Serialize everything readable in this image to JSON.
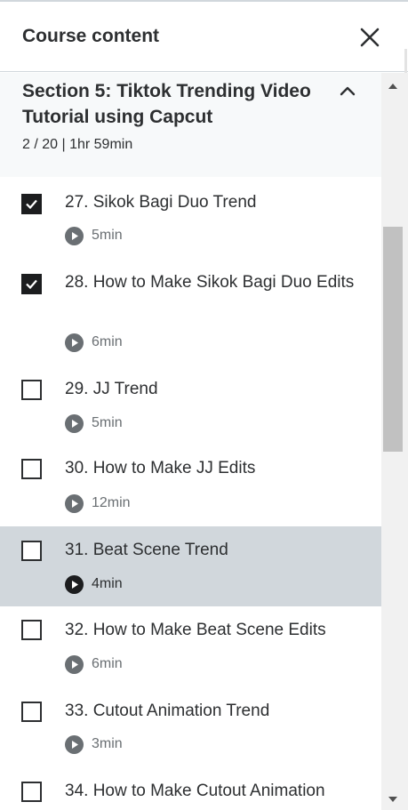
{
  "header": {
    "title": "Course content"
  },
  "section": {
    "title": "Section 5: Tiktok Trending Video Tutorial using Capcut",
    "meta": "2 / 20 | 1hr 59min"
  },
  "lectures": [
    {
      "title": "27. Sikok Bagi Duo Trend",
      "duration": "5min",
      "completed": true,
      "active": false
    },
    {
      "title": "28. How to Make Sikok Bagi Duo Edits",
      "duration": "6min",
      "completed": true,
      "active": false
    },
    {
      "title": "29. JJ Trend",
      "duration": "5min",
      "completed": false,
      "active": false
    },
    {
      "title": "30. How to Make JJ Edits",
      "duration": "12min",
      "completed": false,
      "active": false
    },
    {
      "title": "31. Beat Scene Trend",
      "duration": "4min",
      "completed": false,
      "active": true
    },
    {
      "title": "32. How to Make Beat Scene Edits",
      "duration": "6min",
      "completed": false,
      "active": false
    },
    {
      "title": "33. Cutout Animation Trend",
      "duration": "3min",
      "completed": false,
      "active": false
    },
    {
      "title": "34. How to Make Cutout Animation",
      "duration": "",
      "completed": false,
      "active": false
    }
  ],
  "icons": {
    "close": "close-icon",
    "collapse": "chevron-up-icon",
    "play": "play-icon",
    "check": "checkmark-icon"
  },
  "colors": {
    "text": "#2d2f31",
    "muted": "#6a6f73",
    "active_bg": "#d1d7dc",
    "section_bg": "#f7f9fa"
  }
}
